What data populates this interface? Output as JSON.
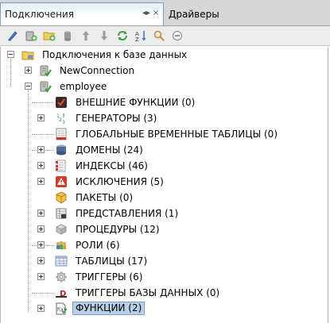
{
  "tabs": [
    {
      "label": "Подключения",
      "active": true
    },
    {
      "label": "Драйверы",
      "active": false
    }
  ],
  "tab_controls": {
    "minimize_glyph": "◂▸",
    "close_glyph": "×"
  },
  "toolbar": {
    "buttons": [
      "edit-pen-icon",
      "new-connection-icon",
      "new-folder-icon",
      "database-icon",
      "move-up-icon",
      "move-down-icon",
      "refresh-icon",
      "sort-icon",
      "search-icon",
      "collapse-icon"
    ]
  },
  "tree": {
    "root": {
      "label": "Подключения к базе данных",
      "icon": "folder-db-icon"
    },
    "connections": [
      {
        "label": "NewConnection",
        "icon": "connection-ok-icon",
        "expanded": false
      },
      {
        "label": "employee",
        "icon": "connection-ok-icon",
        "expanded": true
      }
    ],
    "children": [
      {
        "label": "ВНЕШНИЕ ФУНКЦИИ (0)",
        "icon": "external-functions-icon",
        "expandable": false
      },
      {
        "label": "ГЕНЕРАТОРЫ (3)",
        "icon": "generators-icon",
        "expandable": true
      },
      {
        "label": "ГЛОБАЛЬНЫЕ ВРЕМЕННЫЕ ТАБЛИЦЫ (0)",
        "icon": "global-temp-tables-icon",
        "expandable": false
      },
      {
        "label": "ДОМЕНЫ (24)",
        "icon": "domains-icon",
        "expandable": true
      },
      {
        "label": "ИНДЕКСЫ (46)",
        "icon": "indexes-icon",
        "expandable": true
      },
      {
        "label": "ИСКЛЮЧЕНИЯ (5)",
        "icon": "exceptions-icon",
        "expandable": true
      },
      {
        "label": "ПАКЕТЫ (0)",
        "icon": "packages-icon",
        "expandable": false
      },
      {
        "label": "ПРЕДСТАВЛЕНИЯ (1)",
        "icon": "views-icon",
        "expandable": true
      },
      {
        "label": "ПРОЦЕДУРЫ (12)",
        "icon": "procedures-icon",
        "expandable": true
      },
      {
        "label": "РОЛИ (6)",
        "icon": "roles-icon",
        "expandable": true
      },
      {
        "label": "ТАБЛИЦЫ (17)",
        "icon": "tables-icon",
        "expandable": true
      },
      {
        "label": "ТРИГГЕРЫ (6)",
        "icon": "triggers-icon",
        "expandable": true
      },
      {
        "label": "ТРИГГЕРЫ БАЗЫ ДАННЫХ (0)",
        "icon": "db-triggers-icon",
        "expandable": false
      },
      {
        "label": "ФУНКЦИИ (2)",
        "icon": "functions-icon",
        "expandable": true,
        "selected": true
      }
    ]
  },
  "colors": {
    "selection_bg": "#b8cfe8",
    "selection_border": "#7e9cc4",
    "tab_bar_bg": "#d6d6d6",
    "toolbar_bg": "#ececec"
  }
}
